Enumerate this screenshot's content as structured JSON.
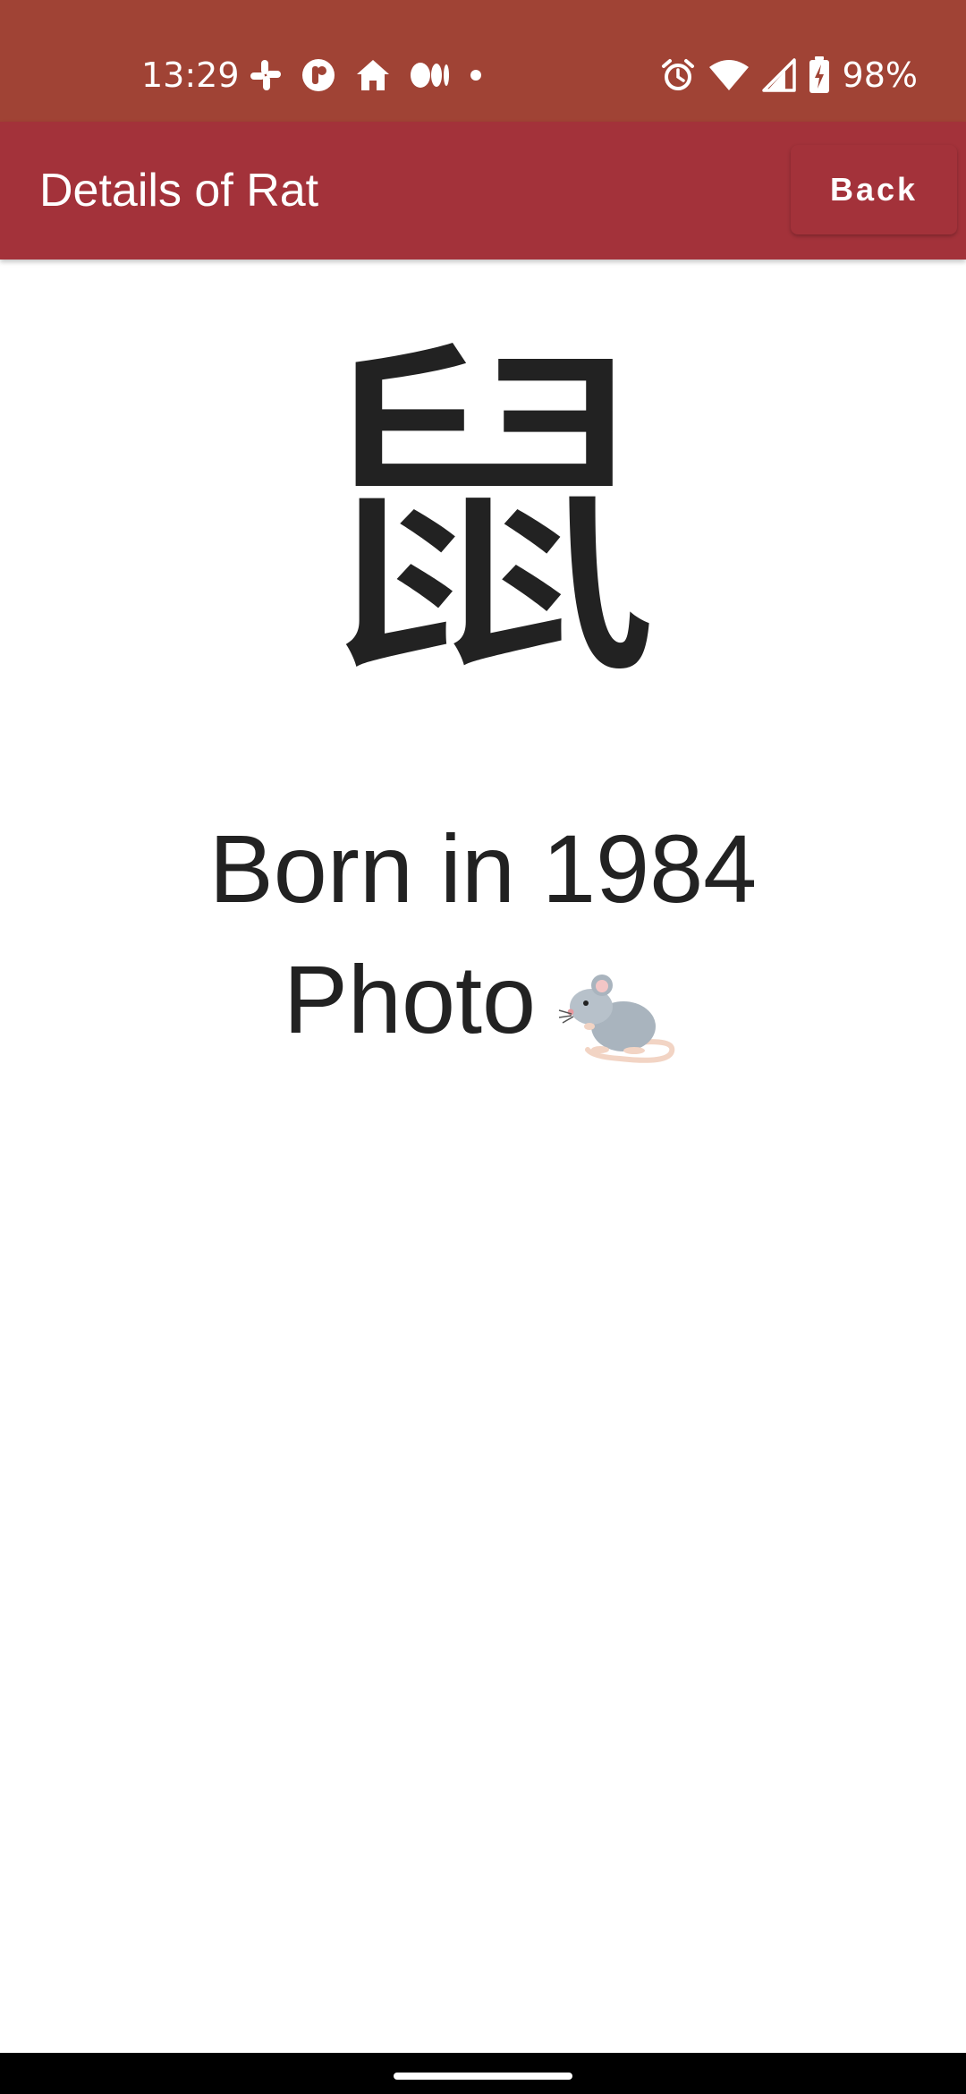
{
  "status_bar": {
    "time": "13:29",
    "battery": "98%",
    "color": "#a04335",
    "left_icons": [
      "slack-icon",
      "notification-app-icon",
      "home-icon",
      "medium-icon",
      "dot-icon"
    ],
    "right_icons": [
      "alarm-icon",
      "wifi-icon",
      "signal-icon",
      "battery-charging-icon"
    ]
  },
  "app_bar": {
    "title": "Details of Rat",
    "back_label": "Back",
    "color": "#a3323a"
  },
  "content": {
    "zodiac_character": "鼠",
    "born_text": "Born in 1984",
    "photo_label": "Photo",
    "photo_icon": "rat-emoji-icon"
  }
}
